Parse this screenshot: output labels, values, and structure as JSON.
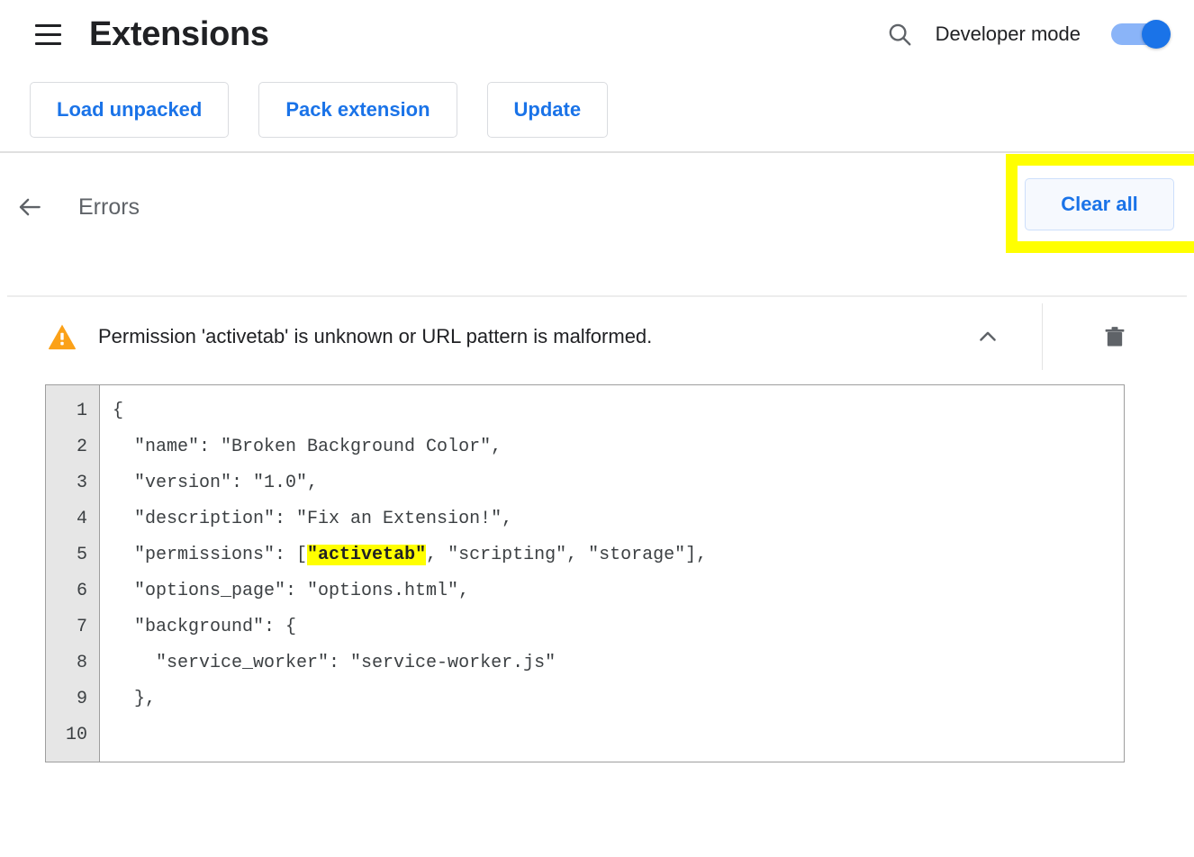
{
  "header": {
    "menu_icon": "hamburger-menu-icon",
    "title": "Extensions",
    "search_icon": "search-icon",
    "developer_mode_label": "Developer mode",
    "developer_mode_on": true,
    "toggle_track_color": "#8ab4f8",
    "toggle_knob_color": "#1a73e8"
  },
  "toolbar": {
    "buttons": [
      {
        "label": "Load unpacked"
      },
      {
        "label": "Pack extension"
      },
      {
        "label": "Update"
      }
    ],
    "accent_color": "#1a73e8",
    "border_color": "#dadce0"
  },
  "errors_header": {
    "back_icon": "back-arrow-icon",
    "title": "Errors",
    "clear_all_label": "Clear all",
    "highlight_color": "#ffff00",
    "clear_all_bg": "#f6f9fe",
    "clear_all_border": "#cddffb"
  },
  "error_item": {
    "severity_icon": "warning-triangle-icon",
    "severity_color": "#fba118",
    "message": "Permission 'activetab' is unknown or URL pattern is malformed.",
    "collapse_icon": "chevron-up-icon",
    "delete_icon": "trash-icon",
    "expanded": true
  },
  "code_block": {
    "line_numbers": [
      "1",
      "2",
      "3",
      "4",
      "5",
      "6",
      "7",
      "8",
      "9",
      "10"
    ],
    "lines": [
      "{",
      "  \"name\": \"Broken Background Color\",",
      "  \"version\": \"1.0\",",
      "  \"description\": \"Fix an Extension!\",",
      "  \"permissions\": [",
      "  \"options_page\": \"options.html\",",
      "  \"background\": {",
      "    \"service_worker\": \"service-worker.js\"",
      "  },",
      ""
    ],
    "line5_prefix": "  \"permissions\": [",
    "line5_highlight": "\"activetab\"",
    "line5_suffix": ", \"scripting\", \"storage\"],",
    "highlight_color": "#ffff00",
    "gutter_bg": "#e6e6e6",
    "border_color": "#9e9e9e",
    "text_color": "#3c4043"
  }
}
